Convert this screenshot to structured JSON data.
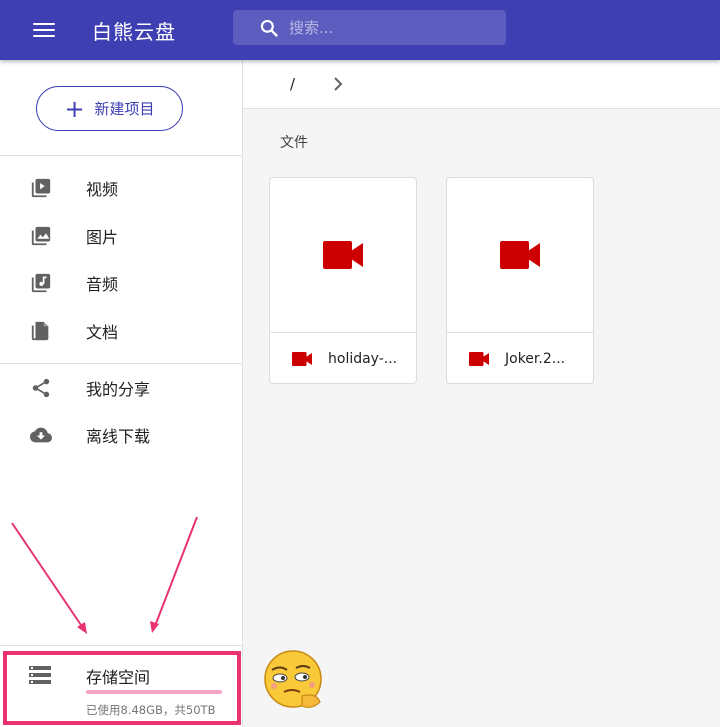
{
  "header": {
    "menu_icon": "hamburger-menu-icon",
    "title": "白熊云盘",
    "search": {
      "icon": "search-icon",
      "placeholder": "搜索..."
    },
    "background_color": "#3f3fb4"
  },
  "sidebar": {
    "new_button": {
      "icon": "plus-icon",
      "label": "新建项目"
    },
    "items": [
      {
        "icon": "video-library-icon",
        "label": "视频"
      },
      {
        "icon": "image-icon",
        "label": "图片"
      },
      {
        "icon": "music-library-icon",
        "label": "音频"
      },
      {
        "icon": "document-icon",
        "label": "文档"
      },
      {
        "icon": "share-icon",
        "label": "我的分享"
      },
      {
        "icon": "cloud-download-icon",
        "label": "离线下载"
      }
    ],
    "storage": {
      "icon": "storage-icon",
      "title": "存储空间",
      "usage_text": "已使用8.48GB，共50TB",
      "used_fraction": 0.0002
    }
  },
  "main": {
    "breadcrumb": {
      "root": "/",
      "chevron_icon": "chevron-right-icon"
    },
    "section_label": "文件",
    "files": [
      {
        "name": "holiday-...",
        "icon": "video-camera-icon"
      },
      {
        "name": "Joker.2...",
        "icon": "video-camera-icon"
      }
    ]
  },
  "annotation": {
    "highlight_color": "#e8336f",
    "arrow_color": "#e8336f",
    "emoji": "thinking-face-sticker"
  },
  "colors": {
    "accent": "#3f3fb4",
    "video_icon": "#cc0000",
    "storage_bar": "#e91e63"
  }
}
